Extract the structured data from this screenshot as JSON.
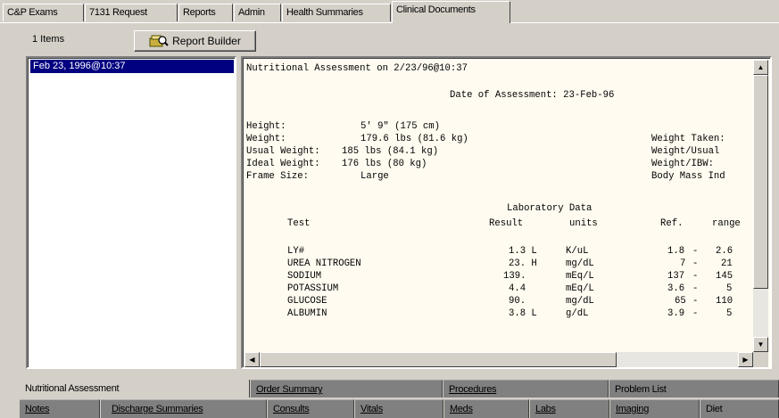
{
  "top_tabs": [
    "C&P Exams",
    "7131 Request",
    "Reports",
    "Admin",
    "Health Summaries",
    "Clinical Documents"
  ],
  "active_top_tab": "Clinical Documents",
  "items_count": "1 Items",
  "report_builder_label": "Report Builder",
  "list_items": [
    "Feb 23, 1996@10:37"
  ],
  "document": {
    "title_line": "Nutritional Assessment on 2/23/96@10:37",
    "date_line": "Date of Assessment: 23-Feb-96",
    "measures_left": [
      {
        "label": "Height:",
        "value": "5' 9\" (175 cm)"
      },
      {
        "label": "Weight:",
        "value": "179.6 lbs (81.6 kg)"
      },
      {
        "label": "Usual Weight:",
        "value": "185 lbs (84.1 kg)"
      },
      {
        "label": "Ideal Weight:",
        "value": "176 lbs (80 kg)"
      },
      {
        "label": "Frame Size:",
        "value": "Large"
      }
    ],
    "measures_right": [
      "Weight Taken:",
      "Weight/Usual",
      "Weight/IBW:",
      "Body Mass Ind"
    ],
    "lab_heading": "Laboratory Data",
    "lab_columns": {
      "test": "Test",
      "result": "Result",
      "units": "units",
      "ref": "Ref.",
      "range": "range"
    },
    "labs": [
      {
        "test": "LY#",
        "result": "1.3 L",
        "units": "K/uL",
        "low": "1.8",
        "high": "2.6"
      },
      {
        "test": "UREA NITROGEN",
        "result": "23. H",
        "units": "mg/dL",
        "low": "7",
        "high": "21"
      },
      {
        "test": "SODIUM",
        "result": "139.",
        "units": "mEq/L",
        "low": "137",
        "high": "145"
      },
      {
        "test": "POTASSIUM",
        "result": "4.4",
        "units": "mEq/L",
        "low": "3.6",
        "high": "5"
      },
      {
        "test": "GLUCOSE",
        "result": "90.",
        "units": "mg/dL",
        "low": "65",
        "high": "110"
      },
      {
        "test": "ALBUMIN",
        "result": "3.8 L",
        "units": "g/dL",
        "low": "3.9",
        "high": "5"
      }
    ]
  },
  "bottom_tabs_row1": [
    "Nutritional Assessment",
    "Order Summary",
    "Procedures",
    "Problem List"
  ],
  "bottom_tabs_row2": [
    "Notes",
    "Discharge Summaries",
    "Consults",
    "Vitals",
    "Meds",
    "Labs",
    "Imaging",
    "Diet"
  ],
  "active_bottom_tab": "Nutritional Assessment",
  "colors": {
    "selection": "#000080",
    "document_bg": "#fffbf0",
    "window_bg": "#d4d0c8"
  }
}
